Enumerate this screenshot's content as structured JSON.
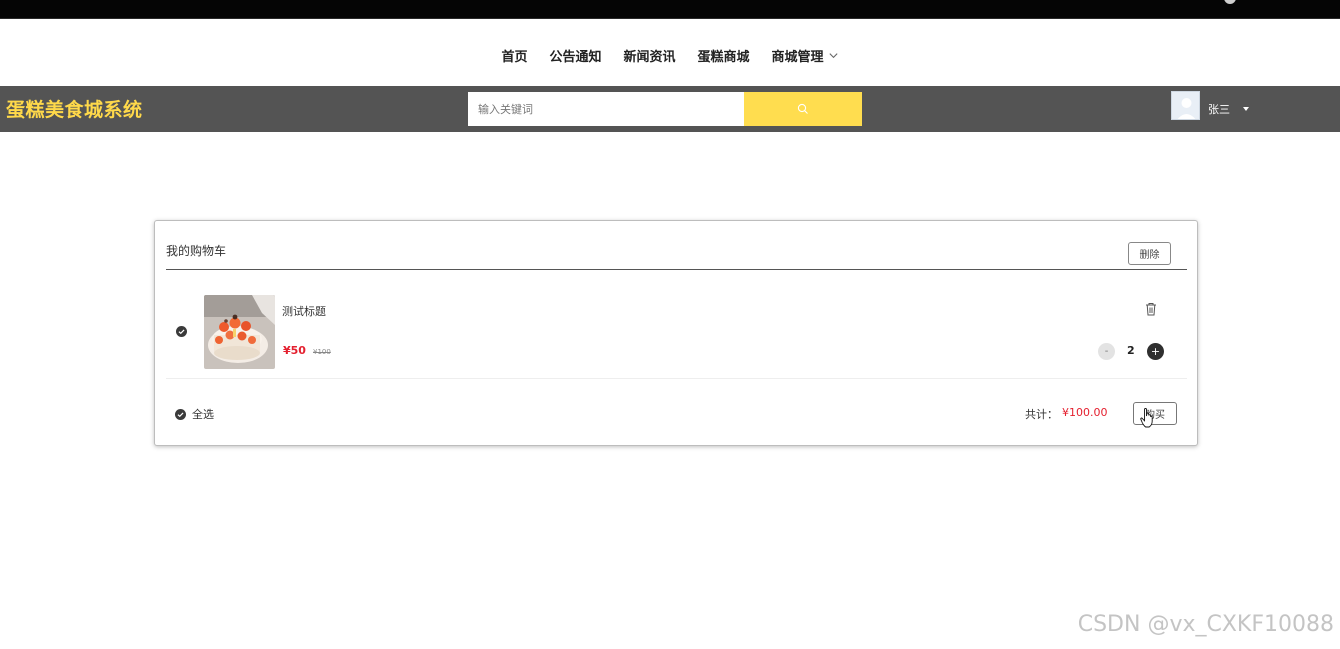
{
  "nav": {
    "items": [
      {
        "label": "首页"
      },
      {
        "label": "公告通知"
      },
      {
        "label": "新闻资讯"
      },
      {
        "label": "蛋糕商城"
      },
      {
        "label": "商城管理"
      }
    ]
  },
  "header": {
    "brand": "蛋糕美食城系统",
    "search_placeholder": "输入关键词",
    "username": "张三"
  },
  "cart": {
    "title": "我的购物车",
    "delete_label": "删除",
    "item": {
      "title": "测试标题",
      "price": "¥50",
      "original_price": "¥100",
      "quantity": "2",
      "minus_label": "-",
      "plus_label": "+"
    },
    "select_all_label": "全选",
    "total_label": "共计：",
    "total_value": "¥100.00",
    "buy_label": "购买"
  },
  "watermark": "CSDN @vx_CXKF10088",
  "colors": {
    "brand": "#ffd94a",
    "header_bg": "#545454",
    "search_button": "#ffdd4f",
    "price": "#e4202f"
  },
  "icons": {
    "search": "search-icon",
    "trash": "trash-icon",
    "check": "check-circle-icon",
    "dropdown": "chevron-down-icon"
  }
}
